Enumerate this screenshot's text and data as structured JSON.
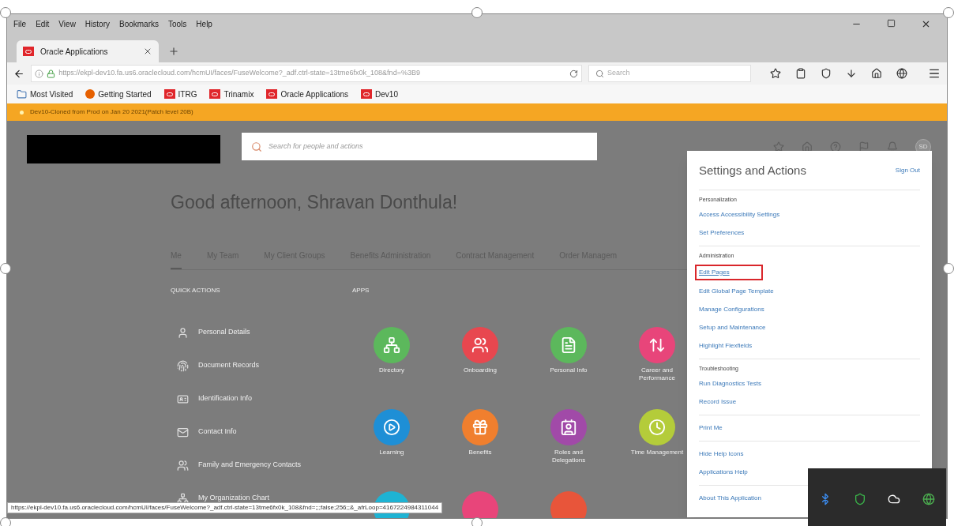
{
  "browser": {
    "menu": [
      "File",
      "Edit",
      "View",
      "History",
      "Bookmarks",
      "Tools",
      "Help"
    ],
    "tabs": [
      {
        "label": "Oracle Applications",
        "selected": true
      }
    ],
    "url": "https://ekpl-dev10.fa.us6.oraclecloud.com/hcmUI/faces/FuseWelcome?_adf.ctrl-state=13tme6fx0k_108&fnd=%3B9",
    "search": {
      "placeholder": "Search"
    },
    "bookmarks": [
      {
        "label": "Most Visited",
        "kind": "folder"
      },
      {
        "label": "Getting Started",
        "kind": "firefox"
      },
      {
        "label": "ITRG",
        "kind": "oracle"
      },
      {
        "label": "Trinamix",
        "kind": "oracle"
      },
      {
        "label": "Oracle Applications",
        "kind": "oracle"
      },
      {
        "label": "Dev10",
        "kind": "oracle"
      }
    ],
    "notice": "Dev10-Cloned from Prod on Jan 20 2021(Patch level 20B)",
    "status_url": "https://ekpl-dev10.fa.us6.oraclecloud.com/hcmUI/faces/FuseWelcome?_adf.ctrl-state=13tme6fx0k_108&fnd=;;;false;256;;&_afrLoop=4167224984311044"
  },
  "page": {
    "search": {
      "placeholder": "Search for people and actions"
    },
    "avatar": "SD",
    "greeting": "Good afternoon, Shravan Donthula!",
    "tabs": [
      {
        "label": "Me",
        "selected": true
      },
      {
        "label": "My Team",
        "selected": false
      },
      {
        "label": "My Client Groups",
        "selected": false
      },
      {
        "label": "Benefits Administration",
        "selected": false
      },
      {
        "label": "Contract Management",
        "selected": false
      },
      {
        "label": "Order Managem",
        "selected": false
      }
    ],
    "quick_actions": {
      "title": "QUICK ACTIONS",
      "items": [
        "Personal Details",
        "Document Records",
        "Identification Info",
        "Contact Info",
        "Family and Emergency Contacts",
        "My Organization Chart"
      ]
    },
    "apps": {
      "title": "APPS",
      "items": [
        {
          "label": "Directory",
          "color": "#5cb85c"
        },
        {
          "label": "Onboarding",
          "color": "#e8474f"
        },
        {
          "label": "Personal Info",
          "color": "#5cb85c"
        },
        {
          "label": "Career and Performance",
          "color": "#e8457a"
        },
        {
          "label": "Learning",
          "color": "#1e8fd6"
        },
        {
          "label": "Benefits",
          "color": "#f07f2e"
        },
        {
          "label": "Roles and Delegations",
          "color": "#a14aa8"
        },
        {
          "label": "Time Management",
          "color": "#b4cc3a"
        }
      ],
      "partial": [
        {
          "color": "#1eb3d3"
        },
        {
          "color": "#e8457a"
        },
        {
          "color": "#e8553a"
        }
      ]
    }
  },
  "settings_menu": {
    "title": "Settings and Actions",
    "sign_out": "Sign Out",
    "sections": [
      {
        "heading": "Personalization",
        "items": [
          {
            "label": "Access Accessibility Settings",
            "highlighted": false
          },
          {
            "label": "Set Preferences",
            "highlighted": false
          }
        ]
      },
      {
        "heading": "Administration",
        "items": [
          {
            "label": "Edit Pages",
            "highlighted": true
          },
          {
            "label": "Edit Global Page Template",
            "highlighted": false
          },
          {
            "label": "Manage Configurations",
            "highlighted": false
          },
          {
            "label": "Setup and Maintenance",
            "highlighted": false
          },
          {
            "label": "Highlight Flexfields",
            "highlighted": false
          }
        ]
      },
      {
        "heading": "Troubleshooting",
        "items": [
          {
            "label": "Run Diagnostics Tests",
            "highlighted": false
          },
          {
            "label": "Record Issue",
            "highlighted": false
          }
        ]
      },
      {
        "items": [
          {
            "label": "Print Me",
            "highlighted": false
          }
        ]
      },
      {
        "items": [
          {
            "label": "Hide Help Icons",
            "highlighted": false
          },
          {
            "label": "Applications Help",
            "highlighted": false
          }
        ]
      },
      {
        "items": [
          {
            "label": "About This Application",
            "highlighted": false
          }
        ]
      }
    ]
  }
}
